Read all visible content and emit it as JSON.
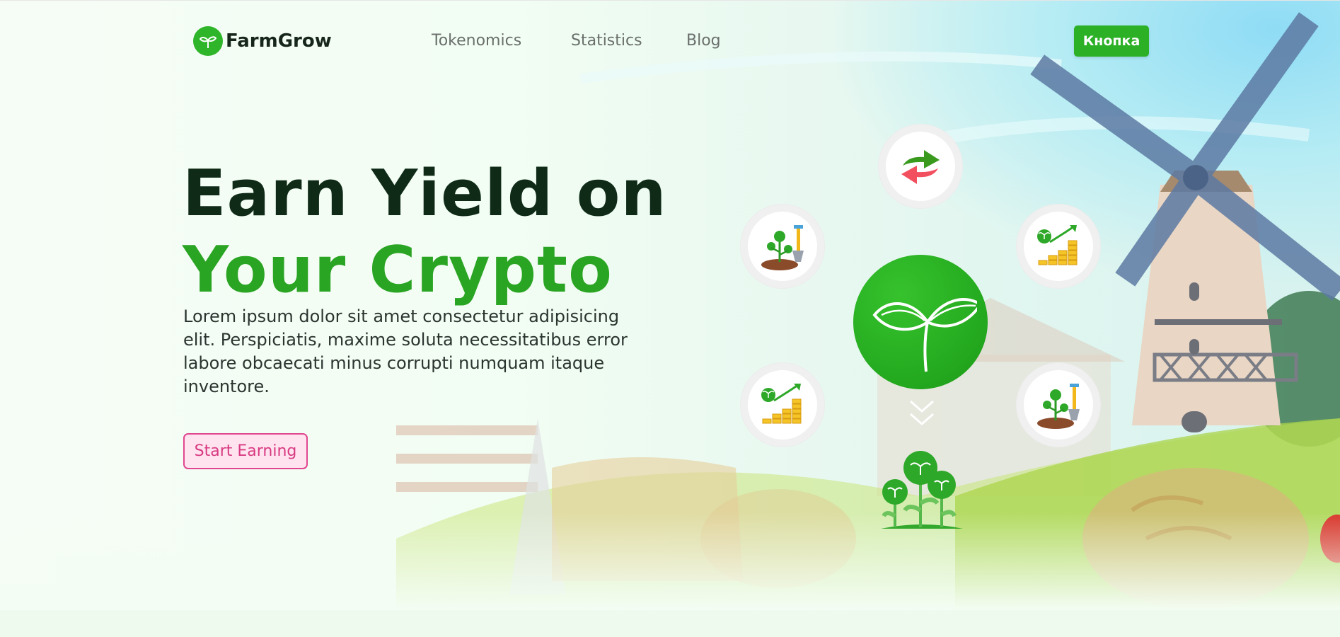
{
  "header": {
    "brand": "FarmGrow",
    "nav": [
      "Tokenomics",
      "Statistics",
      "Blog"
    ],
    "cta": "Кнопка"
  },
  "hero": {
    "title_line1": "Earn Yield on",
    "title_line2": "Your Crypto",
    "description": "Lorem ipsum dolor sit amet consectetur adipisicing elit. Perspiciatis, maxime soluta necessitatibus error labore obcaecati minus corrupti numquam itaque inventore.",
    "cta": "Start Earning"
  },
  "colors": {
    "brand_green": "#2bb026",
    "title_dark": "#0f2b18",
    "cta_pink": "#e0468f",
    "swap_red": "#f2505f"
  },
  "icons": [
    "sprout-logo-icon",
    "swap-arrows-icon",
    "plant-shovel-icon",
    "coins-growth-icon",
    "sprout-icon",
    "chevron-down-icon",
    "plants-icon"
  ]
}
